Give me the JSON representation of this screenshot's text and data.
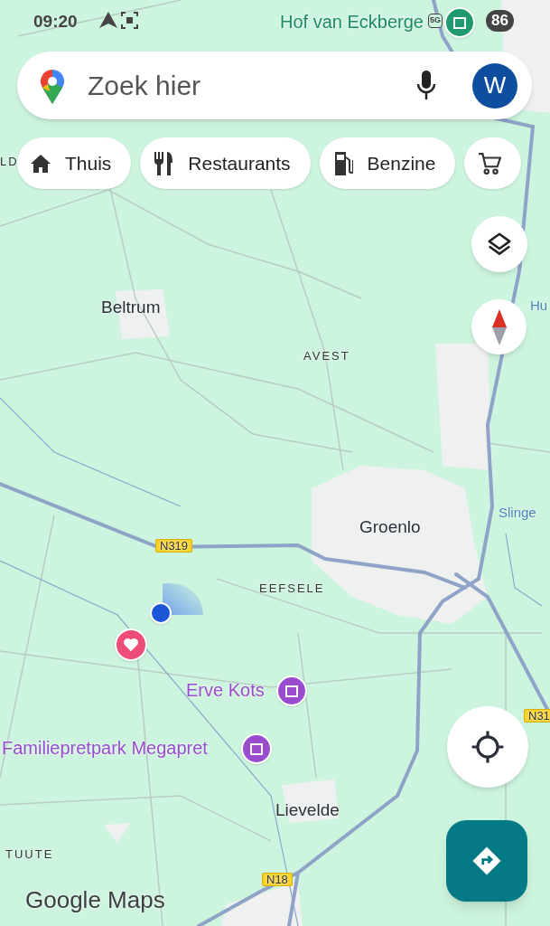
{
  "status_bar": {
    "time": "09:20",
    "network": "5G",
    "battery": "86"
  },
  "search": {
    "placeholder": "Zoek hier",
    "avatar": "W"
  },
  "chips": [
    {
      "kind": "home",
      "label": "Thuis"
    },
    {
      "kind": "restaurant",
      "label": "Restaurants"
    },
    {
      "kind": "fuel",
      "label": "Benzine"
    },
    {
      "kind": "shop"
    }
  ],
  "map_labels": [
    {
      "kind": "poi-green",
      "text": "Hof van Eckberge"
    },
    {
      "kind": "area",
      "text": "LD"
    },
    {
      "kind": "town",
      "text": "Beltrum"
    },
    {
      "kind": "area",
      "text": "AVEST"
    },
    {
      "kind": "water",
      "text": "Hu"
    },
    {
      "kind": "town",
      "text": "Groenlo"
    },
    {
      "kind": "water",
      "text": "Slinge"
    },
    {
      "kind": "road",
      "text": "N319"
    },
    {
      "kind": "area",
      "text": "EEFSELE"
    },
    {
      "kind": "poi-purple",
      "text": "Erve Kots"
    },
    {
      "kind": "poi-purple",
      "text": "Familiepretpark Megapret"
    },
    {
      "kind": "road",
      "text": "N31"
    },
    {
      "kind": "town",
      "text": "Lievelde"
    },
    {
      "kind": "area",
      "text": "TUUTE"
    },
    {
      "kind": "road",
      "text": "N18"
    }
  ],
  "logo": {
    "text": "Google Maps"
  }
}
